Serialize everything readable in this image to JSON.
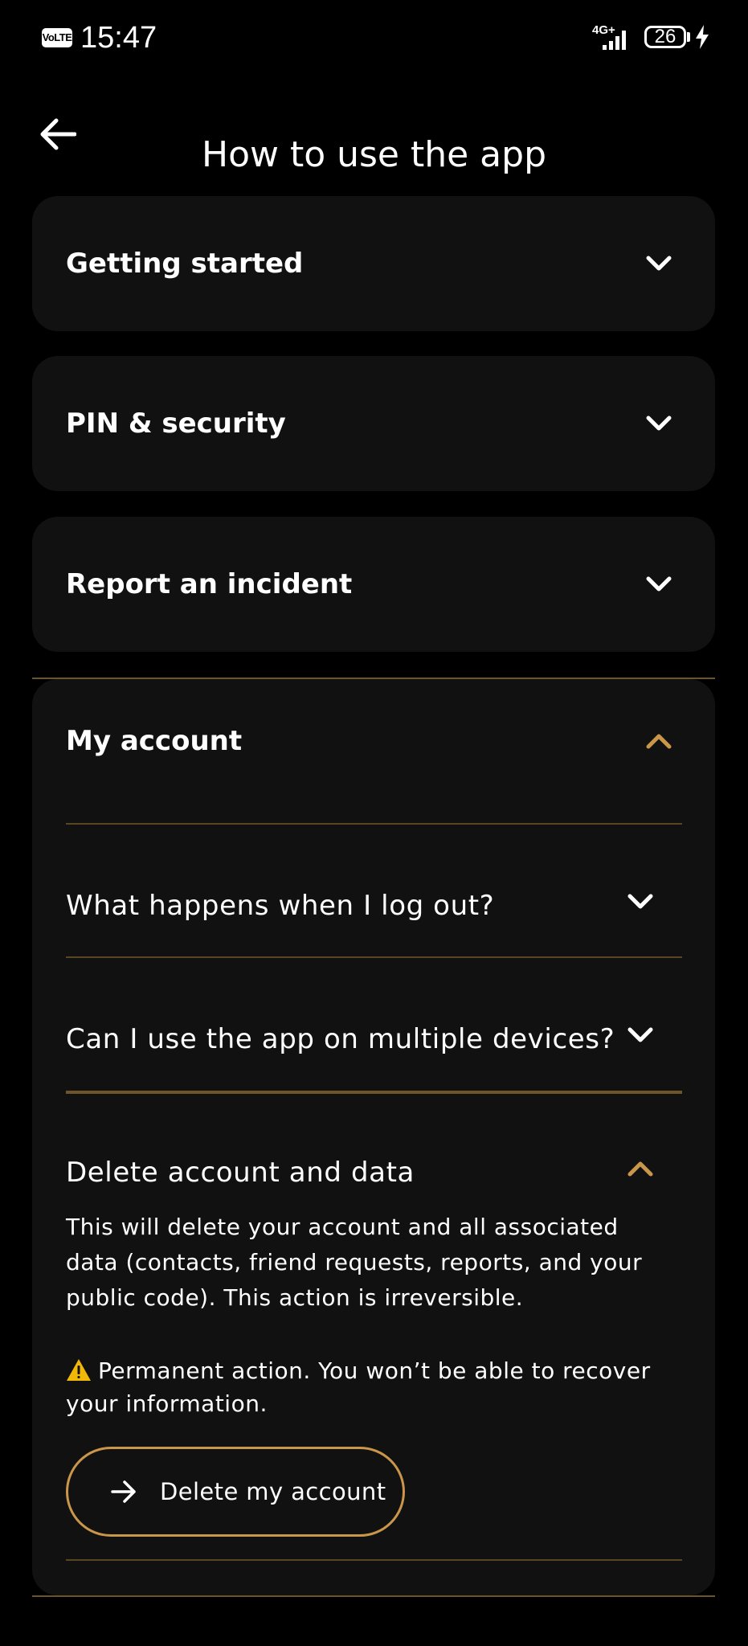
{
  "status_bar": {
    "volte": "VoLTE",
    "time": "15:47",
    "network": "4G+",
    "battery": "26"
  },
  "header": {
    "title": "How to use the app"
  },
  "sections": [
    {
      "label": "Getting started"
    },
    {
      "label": "PIN & security"
    },
    {
      "label": "Report an incident"
    }
  ],
  "my_account": {
    "label": "My account",
    "questions": [
      {
        "label": "What happens when I log out?"
      },
      {
        "label": "Can I use the app on multiple devices?"
      }
    ],
    "delete": {
      "label": "Delete account and data",
      "description": "This will delete your account and all associated data (contacts, friend requests, reports, and your public code). This action is irreversible.",
      "warning": "Permanent action. You won’t be able to recover your information.",
      "button_label": "Delete my account"
    }
  },
  "colors": {
    "accent": "#c9964a",
    "card_bg": "#111111",
    "divider": "#5a4522",
    "background": "#000000"
  }
}
